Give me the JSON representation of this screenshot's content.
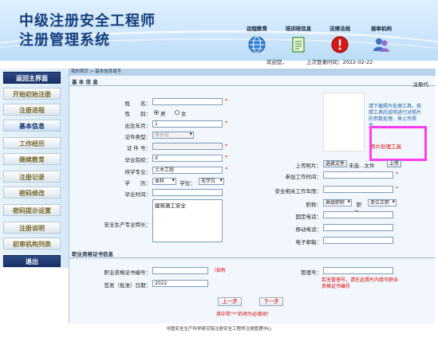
{
  "header": {
    "title_line1": "中级注册安全工程师",
    "title_line2": "注册管理系统",
    "links": [
      {
        "label": "远程教育",
        "icon": "globe-icon"
      },
      {
        "label": "培训班信息",
        "icon": "document-icon"
      },
      {
        "label": "法律法规",
        "icon": "alert-icon"
      },
      {
        "label": "接审机构",
        "icon": "people-icon"
      }
    ],
    "welcome": "欢迎您，",
    "last_login": "上次登录时间：2022-02-22"
  },
  "sidebar": {
    "items": [
      {
        "label": "返回主界面",
        "style": "dark"
      },
      {
        "label": "开始初始注册",
        "style": "normal"
      },
      {
        "label": "注册进程",
        "style": "normal"
      },
      {
        "label": "基本信息",
        "style": "active"
      },
      {
        "label": "工作经历",
        "style": "normal"
      },
      {
        "label": "继续教育",
        "style": "normal"
      },
      {
        "label": "注册记录",
        "style": "normal"
      },
      {
        "label": "密码修改",
        "style": "normal"
      },
      {
        "label": "密码提示设置",
        "style": "normal"
      },
      {
        "label": "注册说明",
        "style": "normal"
      },
      {
        "label": "初审机构列表",
        "style": "normal"
      },
      {
        "label": "退出",
        "style": "dark"
      }
    ]
  },
  "breadcrumb": "我的首页 > 基本信息填写",
  "basic_section": {
    "title": "基 本 信 息",
    "reg_code_label": "注册代",
    "name_label": "姓　　名：",
    "gender_label": "性　　别：",
    "gender_male": "男",
    "gender_female": "女",
    "birth_label": "出生年月：",
    "birth_value": "1",
    "id_type_label": "证件类型：",
    "id_type_value": "身份证",
    "id_no_label": "证 件 号：",
    "school_label": "毕业院校：",
    "school_value": "d",
    "major_label": "所学专业：",
    "major_value": "土木工程",
    "edu_label": "学　　历：",
    "edu_value": "本科",
    "degree_label": "学位：",
    "degree_value": "无学位",
    "grad_label": "毕业时间：",
    "expertise_label": "安全生产专业特长：",
    "expertise_value": "建筑施工安全",
    "photo_label": "上传照片：",
    "photo_button": "选择文件",
    "photo_status": "未选…文件",
    "upload_button": "上传",
    "photo_note": "请下载照片处理工具，按照工具的说明进行对照片的参数处理，再上传照片。",
    "photo_tool_link": "照片处理工具",
    "work_time_label": "参加工作时间：",
    "safety_years_label": "安全相关工作年限：",
    "title_label": "职称：",
    "title_value": "高级职称",
    "position_label": "职务：",
    "position_value": "单位正职",
    "phone_label": "固定电话：",
    "mobile_label": "移动电话：",
    "email_label": "电子邮箱："
  },
  "cert_section": {
    "title": "职业资格证书信息",
    "cert_no_label": "职业资格证书编号：",
    "cert_no_hint": "（如有",
    "manager_label": "管理号：",
    "issue_label": "签发（批准）日期：",
    "issue_value": "2022",
    "note": "若无管理号，请在此照片内填写职业资格证书编号"
  },
  "nav": {
    "prev": "上一步",
    "next": "下一步",
    "required_note": "其中带“*”的项为必填项！"
  },
  "footer": "中国安全生产科学研究院注册安全工程师注册管理中心",
  "colors": {
    "accent_blue": "#123f7c",
    "sidebar_dark": "#173166",
    "highlight_magenta": "#ff3cf0",
    "required_red": "#dd0000"
  }
}
